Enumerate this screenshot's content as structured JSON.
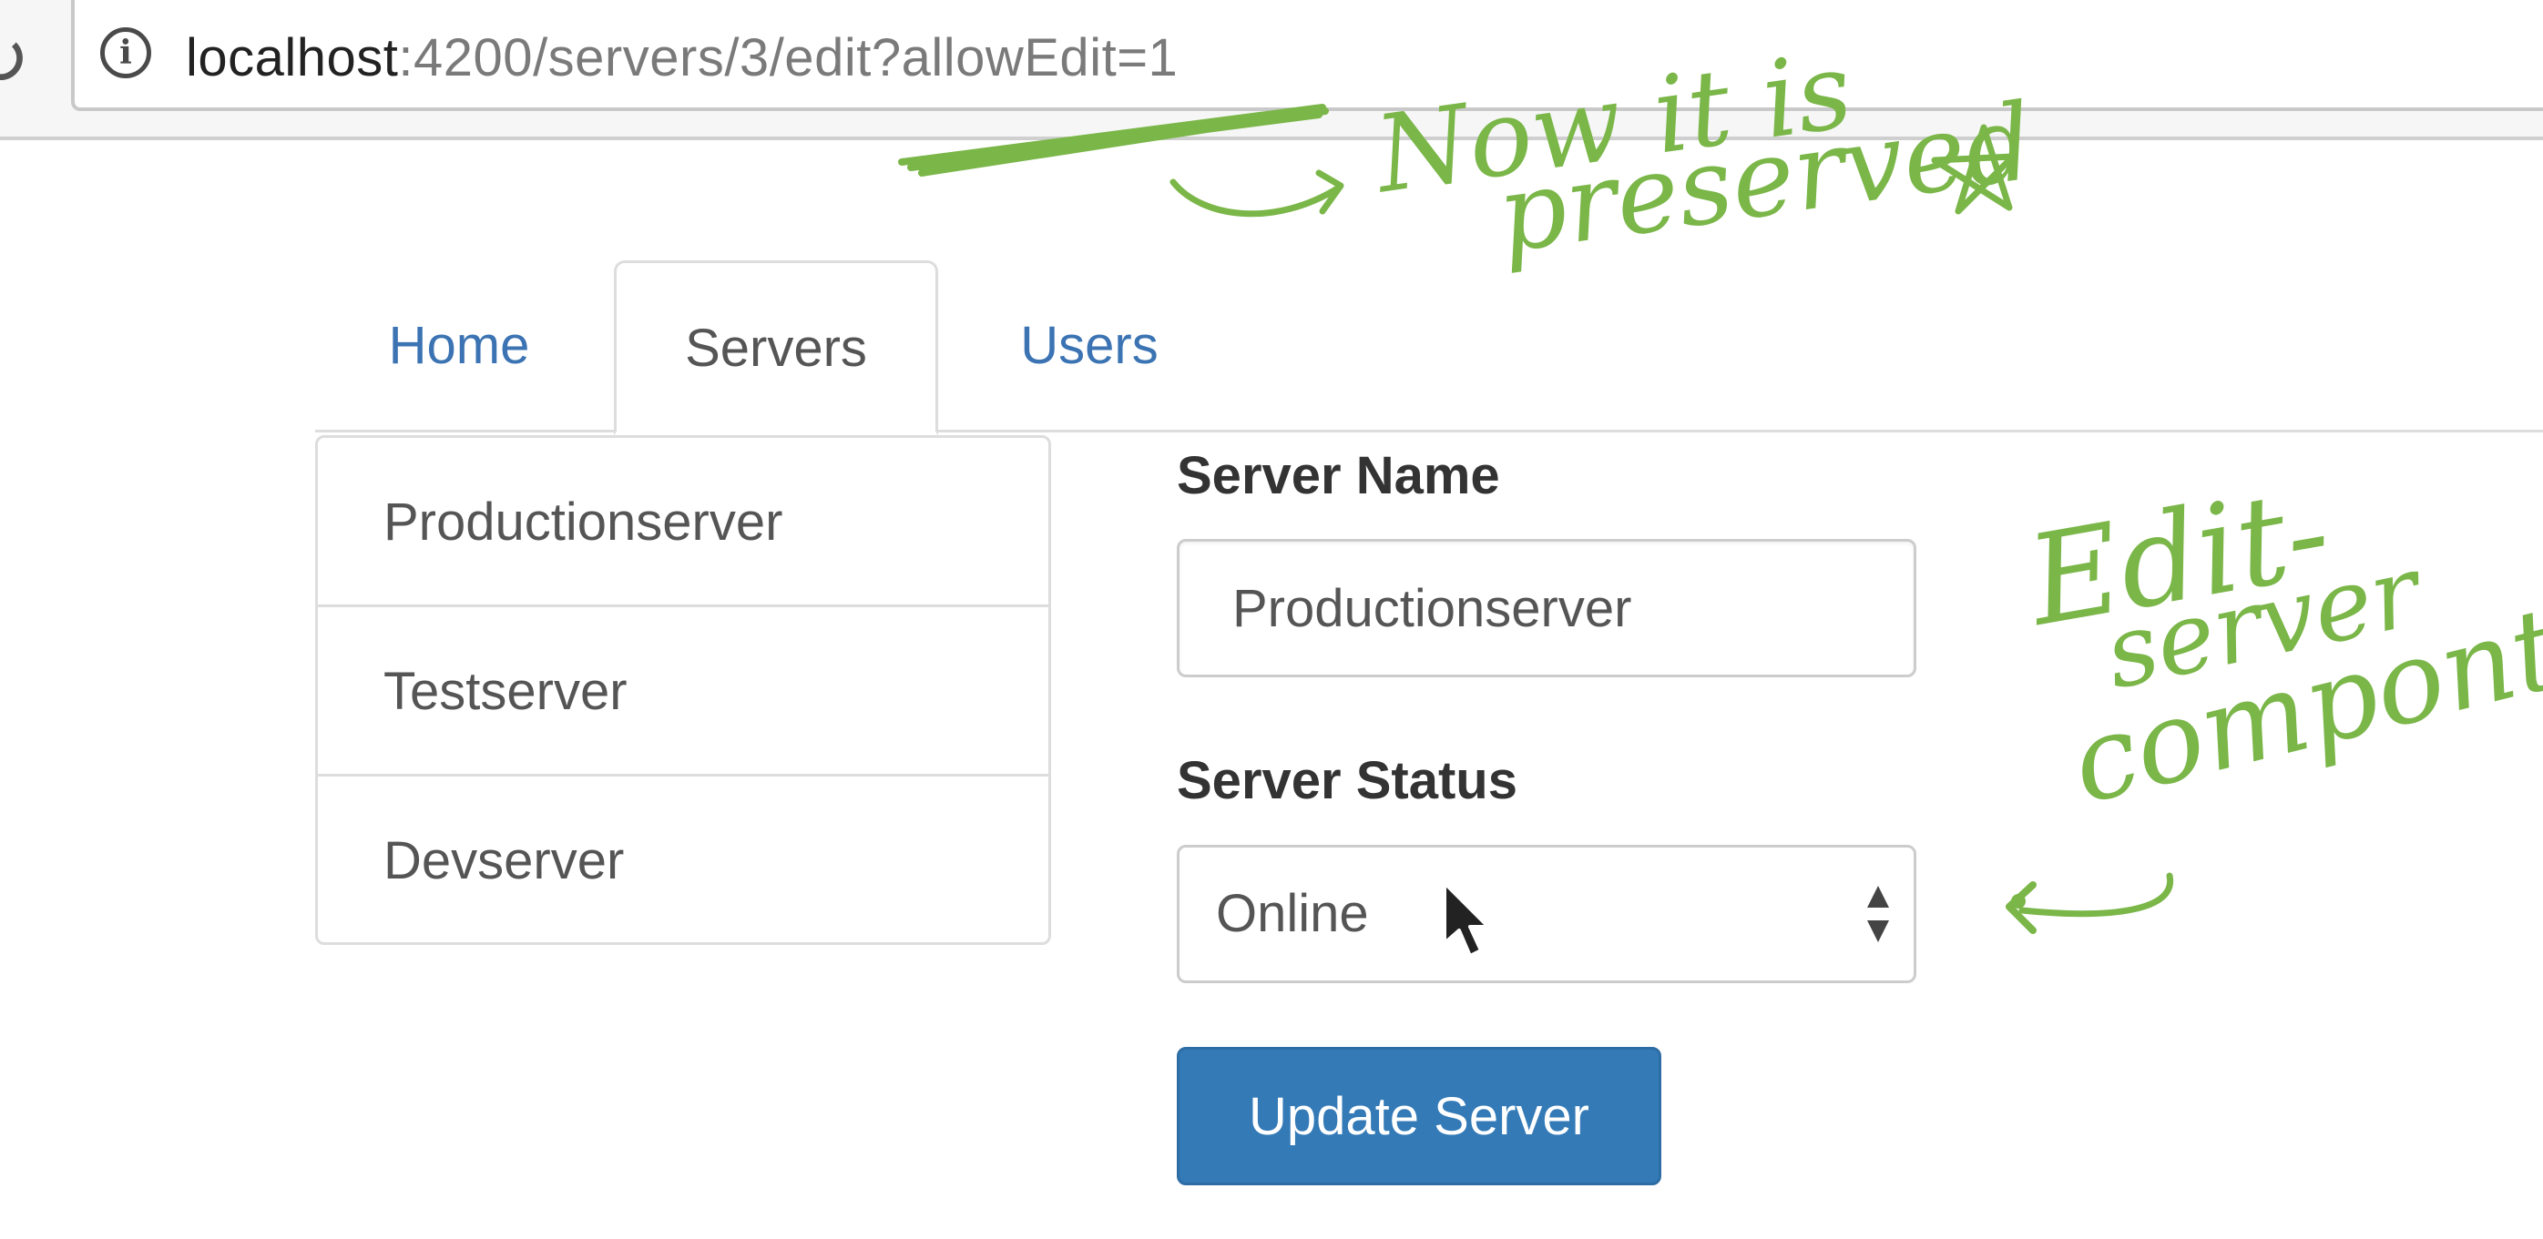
{
  "browser": {
    "url_host": "localhost",
    "url_rest": ":4200/servers/3/edit?allowEdit=1",
    "reload_icon": "reload-icon",
    "info_icon": "info-icon"
  },
  "nav": {
    "tabs": [
      {
        "label": "Home",
        "active": false
      },
      {
        "label": "Servers",
        "active": true
      },
      {
        "label": "Users",
        "active": false
      }
    ]
  },
  "servers": {
    "items": [
      {
        "label": "Productionserver"
      },
      {
        "label": "Testserver"
      },
      {
        "label": "Devserver"
      }
    ]
  },
  "edit_form": {
    "name_label": "Server Name",
    "name_value": "Productionserver",
    "status_label": "Server Status",
    "status_value": "Online",
    "submit_label": "Update Server"
  },
  "annotations": {
    "note_top_line1": "Now it is",
    "note_top_line2": "preserved",
    "note_right_line1": "Edit-",
    "note_right_line2": "server",
    "note_right_line3": "compont",
    "color": "#7ab648"
  },
  "colors": {
    "link": "#3b73b3",
    "primary_button": "#337ab7",
    "annotation": "#7ab648"
  }
}
